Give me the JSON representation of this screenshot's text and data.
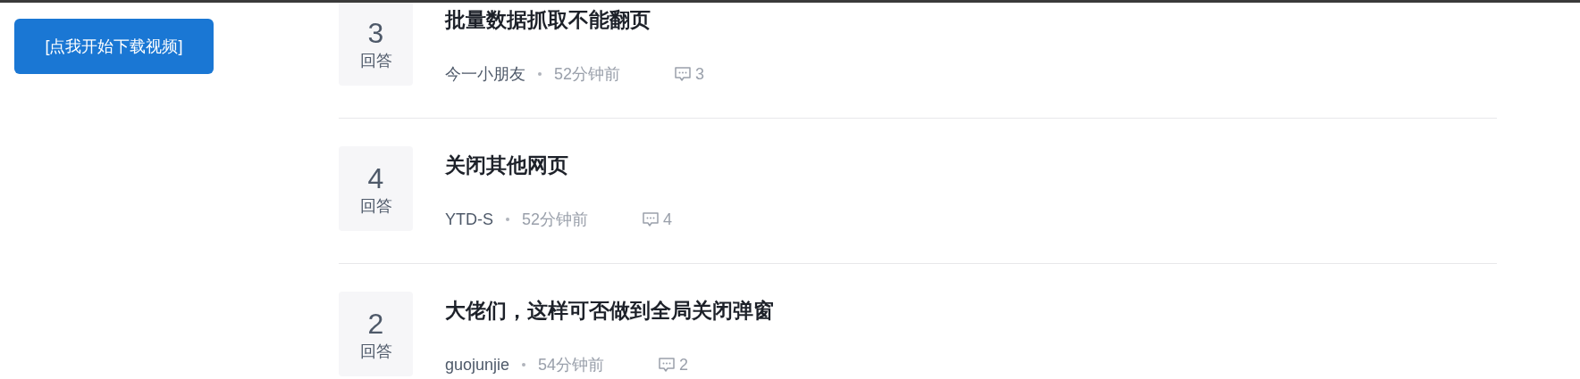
{
  "download_button": "[点我开始下载视频]",
  "questions": [
    {
      "answers": "3",
      "answers_label": "回答",
      "title": "批量数据抓取不能翻页",
      "author": "今一小朋友",
      "time": "52分钟前",
      "comments": "3"
    },
    {
      "answers": "4",
      "answers_label": "回答",
      "title": "关闭其他网页",
      "author": "YTD-S",
      "time": "52分钟前",
      "comments": "4"
    },
    {
      "answers": "2",
      "answers_label": "回答",
      "title": "大佬们，这样可否做到全局关闭弹窗",
      "author": "guojunjie",
      "time": "54分钟前",
      "comments": "2"
    }
  ]
}
